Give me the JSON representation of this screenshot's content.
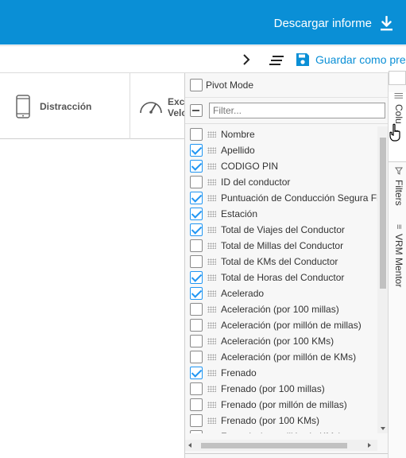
{
  "header": {
    "download_label": "Descargar informe",
    "download_icon": "download-icon",
    "bg_color": "#0a8fd6"
  },
  "toolbar": {
    "save_label": "Guardar como pre",
    "accent_color": "#0a8fd6"
  },
  "grid": {
    "columns": [
      {
        "label": "Distracción",
        "icon": "phone-icon"
      },
      {
        "label_line1": "Exce",
        "label_line2": "Velc",
        "icon": "gauge-icon"
      }
    ]
  },
  "panel": {
    "pivot_label": "Pivot Mode",
    "filter_placeholder": "Filter...",
    "items": [
      {
        "label": "Nombre",
        "checked": false
      },
      {
        "label": "Apellido",
        "checked": true
      },
      {
        "label": "CODIGO PIN",
        "checked": true
      },
      {
        "label": "ID del conductor",
        "checked": false
      },
      {
        "label": "Puntuación de Conducción Segura Fl",
        "checked": true
      },
      {
        "label": "Estación",
        "checked": true
      },
      {
        "label": "Total de Viajes del Conductor",
        "checked": true
      },
      {
        "label": "Total de Millas del Conductor",
        "checked": false
      },
      {
        "label": "Total de KMs del Conductor",
        "checked": false
      },
      {
        "label": "Total de Horas del Conductor",
        "checked": true
      },
      {
        "label": "Acelerado",
        "checked": true
      },
      {
        "label": "Aceleración (por 100 millas)",
        "checked": false
      },
      {
        "label": "Aceleración (por millón de millas)",
        "checked": false
      },
      {
        "label": "Aceleración (por 100 KMs)",
        "checked": false
      },
      {
        "label": "Aceleración (por millón de KMs)",
        "checked": false
      },
      {
        "label": "Frenado",
        "checked": true
      },
      {
        "label": "Frenado (por 100 millas)",
        "checked": false
      },
      {
        "label": "Frenado (por millón de millas)",
        "checked": false
      },
      {
        "label": "Frenado (por 100 KMs)",
        "checked": false
      },
      {
        "label": "Frenado (por millón de KMs)",
        "checked": false
      }
    ]
  },
  "side_tabs": [
    {
      "label": "Colu",
      "icon": "columns-icon"
    },
    {
      "label": "Filters",
      "icon": "filter-icon"
    },
    {
      "label": "VRM Mentor",
      "icon": "menu-icon"
    }
  ]
}
